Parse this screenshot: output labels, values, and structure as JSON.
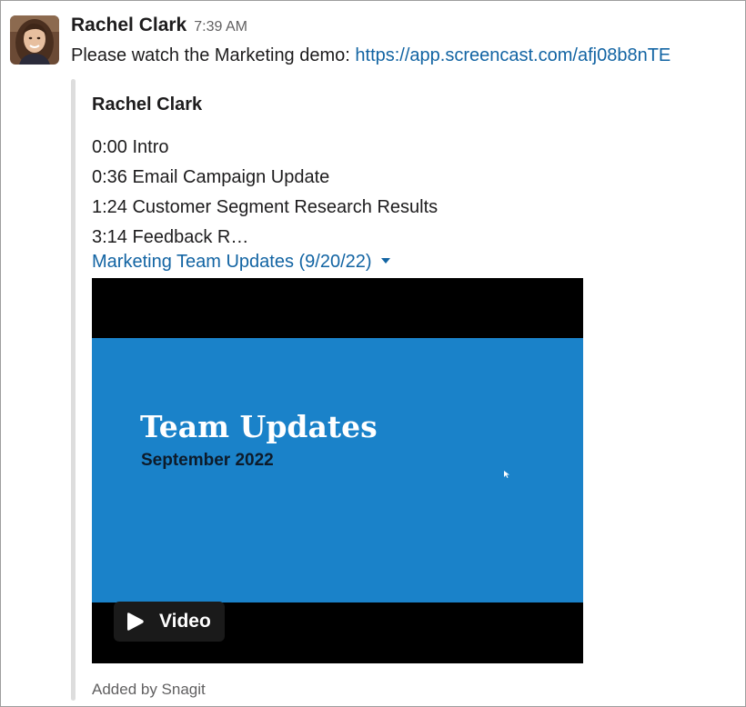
{
  "message": {
    "sender": "Rachel Clark",
    "time": "7:39 AM",
    "text": "Please watch the Marketing demo: ",
    "link": "https://app.screencast.com/afj08b8nTE",
    "avatar_icon": "user-avatar"
  },
  "attachment": {
    "author": "Rachel Clark",
    "chapters": [
      "0:00 Intro",
      "0:36 Email Campaign Update",
      "1:24 Customer Segment Research Results",
      "3:14 Feedback R…"
    ],
    "title": "Marketing Team Updates (9/20/22)",
    "title_icon": "caret-down-icon",
    "video": {
      "slide_title": "Team Updates",
      "slide_subtitle": "September 2022",
      "badge_label": "Video",
      "badge_icon": "play-icon"
    },
    "footer": "Added by Snagit"
  },
  "colors": {
    "link": "#1264a3",
    "slide_background": "#1a82c9",
    "video_background": "#000000",
    "attachment_bar": "#dddddd"
  }
}
